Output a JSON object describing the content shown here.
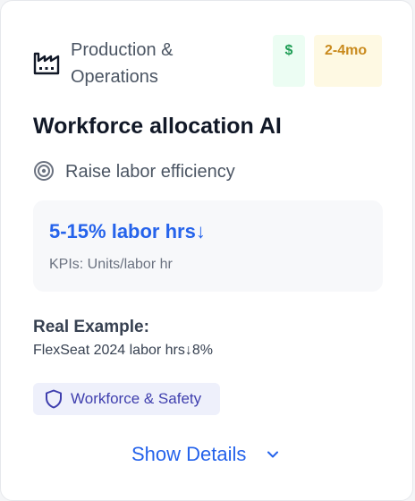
{
  "card": {
    "category": "Production & Operations",
    "cost_badge": "$",
    "time_badge": "2-4mo",
    "title": "Workforce allocation AI",
    "goal": "Raise labor efficiency",
    "metric": {
      "value": "5-15% labor hrs↓",
      "kpis": "KPIs: Units/labor hr"
    },
    "example": {
      "label": "Real Example:",
      "text": "FlexSeat 2024 labor hrs↓8%"
    },
    "tag": "Workforce & Safety",
    "details_label": "Show Details"
  },
  "icons": {
    "category": "factory-icon",
    "goal": "target-icon",
    "tag": "shield-icon",
    "details": "chevron-down-icon"
  },
  "colors": {
    "accent": "#2563eb",
    "cost_badge_text": "#1f9d55",
    "cost_badge_bg": "#ecfdf3",
    "time_badge_text": "#c98a1d",
    "time_badge_bg": "#fef9e3",
    "tag_text": "#3f3fae",
    "tag_bg": "#eef0fb"
  }
}
